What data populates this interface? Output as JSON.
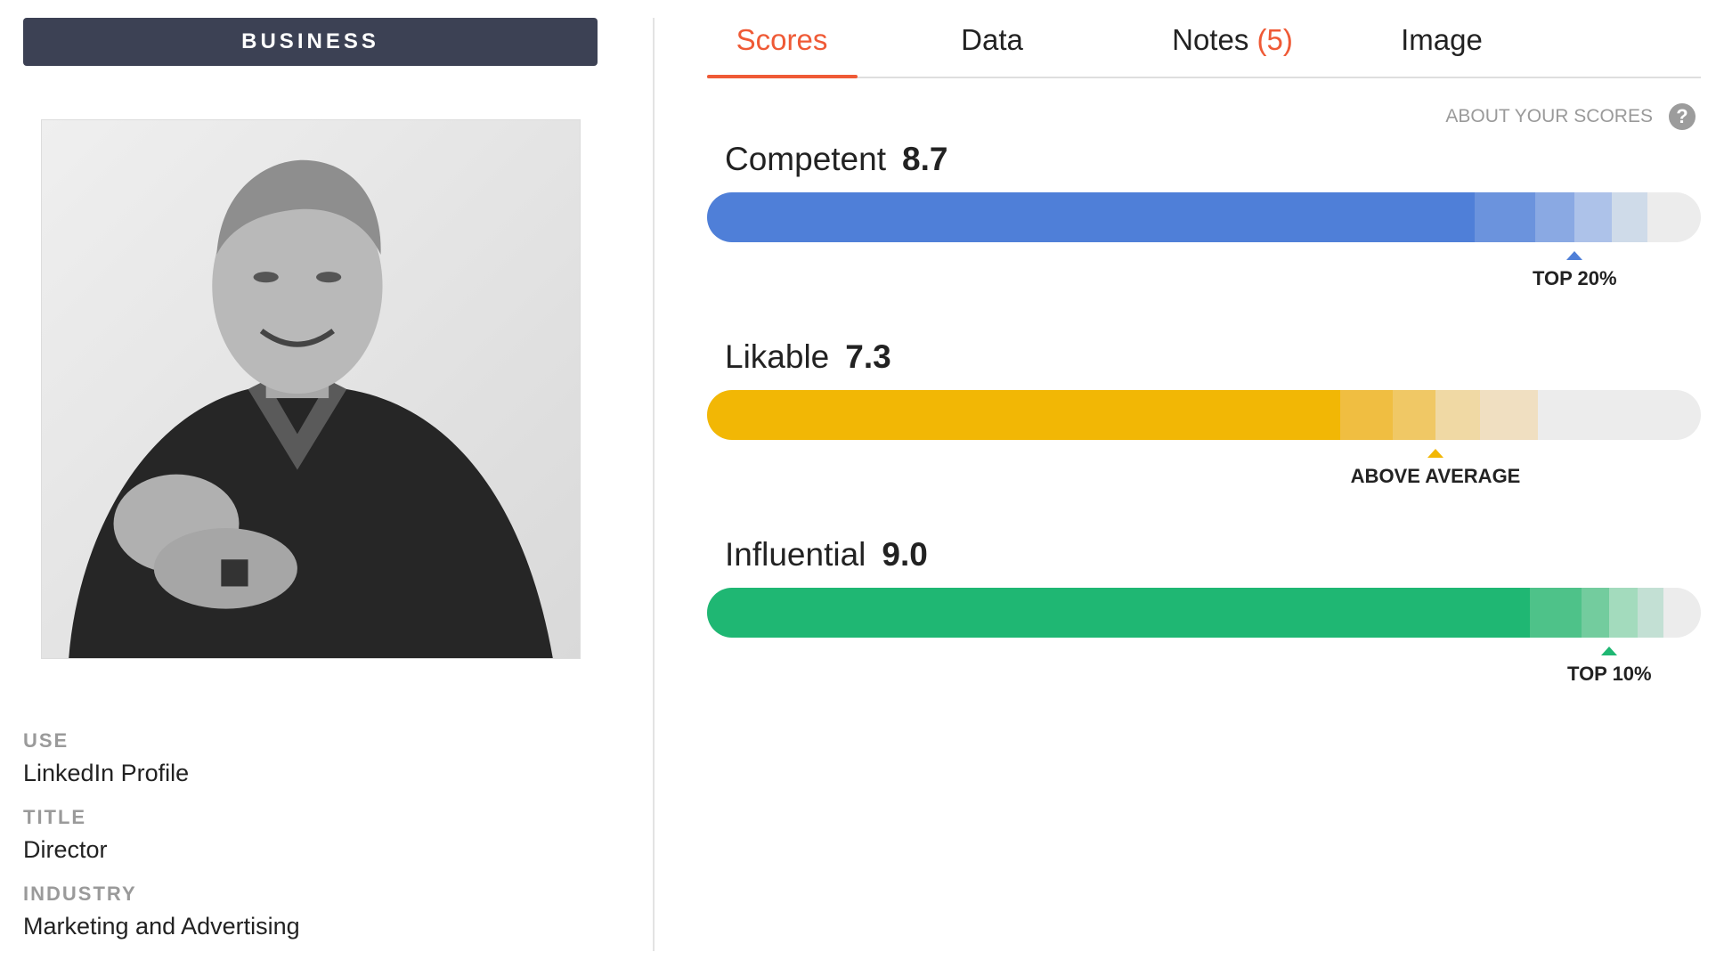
{
  "category": "BUSINESS",
  "meta": [
    {
      "label": "USE",
      "value": "LinkedIn Profile"
    },
    {
      "label": "TITLE",
      "value": "Director"
    },
    {
      "label": "INDUSTRY",
      "value": "Marketing and Advertising"
    }
  ],
  "tabs": [
    {
      "label": "Scores",
      "count": "",
      "active": true
    },
    {
      "label": "Data",
      "count": "",
      "active": false
    },
    {
      "label": "Notes",
      "count": "(5)",
      "active": false
    },
    {
      "label": "Image",
      "count": "",
      "active": false
    }
  ],
  "about_link": "ABOUT YOUR SCORES",
  "help_icon_glyph": "?",
  "colors": {
    "accent": "#ef5a36",
    "competent": "#4f7fd8",
    "likable": "#f2b705",
    "influential": "#1fb773",
    "track": "#ececec"
  },
  "scores": [
    {
      "name": "Competent",
      "value": "8.7",
      "rank": "TOP 20%",
      "color": "#4f7fd8",
      "fill_fraction": 0.772,
      "marker_fraction": 0.873,
      "shades": [
        "#6b93dd",
        "#8aa9e3",
        "#adc2e9",
        "#cfdbe9"
      ],
      "shade_fractions": [
        0.772,
        0.833,
        0.873,
        0.91,
        0.946
      ]
    },
    {
      "name": "Likable",
      "value": "7.3",
      "rank": "ABOVE AVERAGE",
      "color": "#f2b705",
      "fill_fraction": 0.637,
      "marker_fraction": 0.733,
      "shades": [
        "#f0be41",
        "#f0c865",
        "#f0d9a4",
        "#f0dfc1"
      ],
      "shade_fractions": [
        0.637,
        0.69,
        0.733,
        0.778,
        0.836
      ]
    },
    {
      "name": "Influential",
      "value": "9.0",
      "rank": "TOP 10%",
      "color": "#1fb773",
      "fill_fraction": 0.828,
      "marker_fraction": 0.908,
      "shades": [
        "#4ec289",
        "#73cc9e",
        "#a3dbbd",
        "#c3e0d4"
      ],
      "shade_fractions": [
        0.828,
        0.88,
        0.908,
        0.936,
        0.962
      ]
    }
  ]
}
